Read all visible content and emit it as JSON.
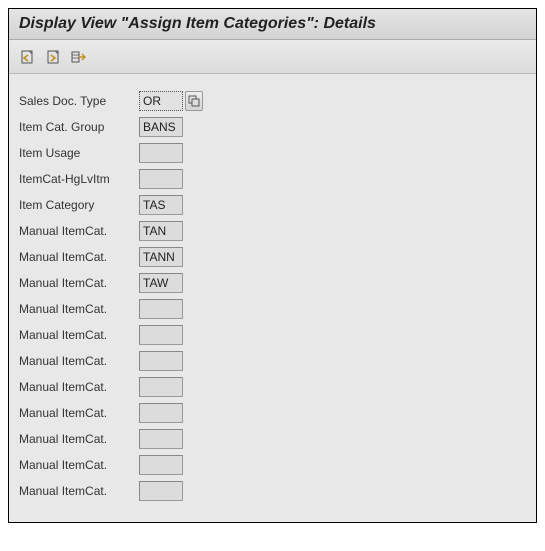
{
  "title": "Display View \"Assign Item Categories\": Details",
  "toolbar": {
    "icon1": "doc-nav-prev",
    "icon2": "doc-nav-next",
    "icon3": "table-view"
  },
  "fields": [
    {
      "label": "Sales Doc. Type",
      "value": "OR",
      "focused": true,
      "f4": true
    },
    {
      "label": "Item Cat. Group",
      "value": "BANS",
      "focused": false,
      "f4": false
    },
    {
      "label": "Item Usage",
      "value": "",
      "focused": false,
      "f4": false
    },
    {
      "label": "ItemCat-HgLvItm",
      "value": "",
      "focused": false,
      "f4": false
    },
    {
      "label": "Item Category",
      "value": "TAS",
      "focused": false,
      "f4": false
    },
    {
      "label": "Manual ItemCat.",
      "value": "TAN",
      "focused": false,
      "f4": false
    },
    {
      "label": "Manual ItemCat.",
      "value": "TANN",
      "focused": false,
      "f4": false
    },
    {
      "label": "Manual ItemCat.",
      "value": "TAW",
      "focused": false,
      "f4": false
    },
    {
      "label": "Manual ItemCat.",
      "value": "",
      "focused": false,
      "f4": false
    },
    {
      "label": "Manual ItemCat.",
      "value": "",
      "focused": false,
      "f4": false
    },
    {
      "label": "Manual ItemCat.",
      "value": "",
      "focused": false,
      "f4": false
    },
    {
      "label": "Manual ItemCat.",
      "value": "",
      "focused": false,
      "f4": false
    },
    {
      "label": "Manual ItemCat.",
      "value": "",
      "focused": false,
      "f4": false
    },
    {
      "label": "Manual ItemCat.",
      "value": "",
      "focused": false,
      "f4": false
    },
    {
      "label": "Manual ItemCat.",
      "value": "",
      "focused": false,
      "f4": false
    },
    {
      "label": "Manual ItemCat.",
      "value": "",
      "focused": false,
      "f4": false
    }
  ]
}
